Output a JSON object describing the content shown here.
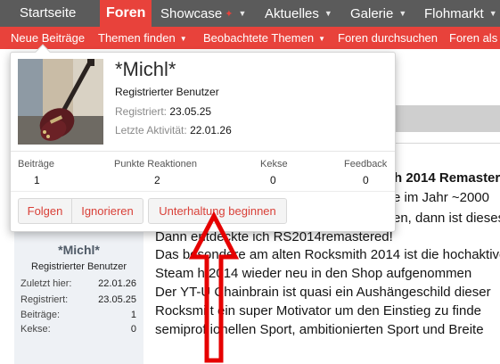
{
  "topnav": {
    "tabs": [
      {
        "label": "Startseite",
        "active": false
      },
      {
        "label": "Foren",
        "active": true
      },
      {
        "label": "Showcase",
        "active": false,
        "badge": "✦"
      },
      {
        "label": "Aktuelles",
        "active": false
      },
      {
        "label": "Galerie",
        "active": false
      },
      {
        "label": "Flohmarkt",
        "active": false
      }
    ]
  },
  "subnav": {
    "items": [
      {
        "label": "Neue Beiträge"
      },
      {
        "label": "Themen finden"
      },
      {
        "label": "Beobachtete Themen"
      },
      {
        "label": "Foren durchsuchen"
      },
      {
        "label": "Foren als g"
      }
    ]
  },
  "card": {
    "name": "*Michl*",
    "role": "Registrierter Benutzer",
    "registered_label": "Registriert:",
    "registered_value": "23.05.25",
    "last_activity_label": "Letzte Aktivität:",
    "last_activity_value": "22.01.26",
    "stats": [
      {
        "label": "Beiträge",
        "value": "1"
      },
      {
        "label": "Punkte Reaktionen",
        "value": "2"
      },
      {
        "label": "Kekse",
        "value": "0"
      },
      {
        "label": "Feedback",
        "value": "0"
      }
    ],
    "buttons": {
      "follow": "Folgen",
      "ignore": "Ignorieren",
      "conversation": "Unterhaltung beginnen"
    }
  },
  "postbit": {
    "name": "*Michl*",
    "role": "Registrierter Benutzer",
    "rows": [
      {
        "label": "Zuletzt hier:",
        "value": "22.01.26"
      },
      {
        "label": "Registriert:",
        "value": "23.05.25"
      },
      {
        "label": "Beiträge:",
        "value": "1"
      },
      {
        "label": "Kekse:",
        "value": "0"
      }
    ]
  },
  "post": {
    "title_fragment": "h 2014 Remaster",
    "lines": [
      "e im Jahr ~2000",
      "en, dann ist dieses",
      "Dann entdeckte ich RS2014remastered!",
      "Das besondere am alten Rocksmith 2014 ist die hochaktive",
      "Steam h     2014 wieder neu in den Shop aufgenommen",
      "Der YT-U     Chainbrain ist quasi ein Aushängeschild dieser",
      "Rocksmi     t ein super Motivator um den Einstieg zu finde",
      "semiprof     ionellen Sport, ambitionierten Sport und Breite"
    ]
  },
  "colors": {
    "accent": "#e8423b",
    "nav_bg": "#5b5b5b",
    "postbit_bg": "#eef1f5",
    "arrow": "#e60000"
  }
}
